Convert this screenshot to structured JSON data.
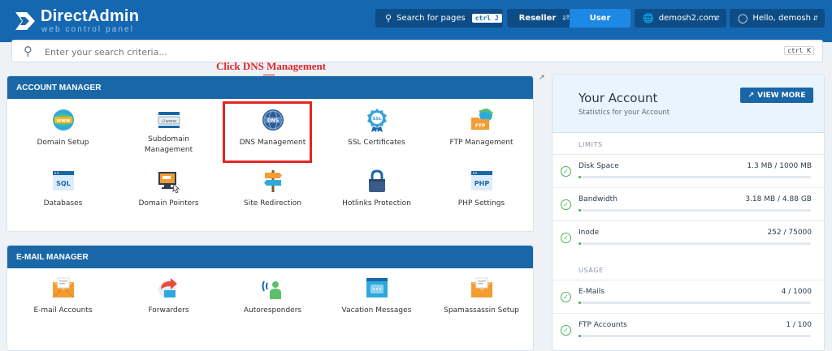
{
  "header": {
    "brand": "DirectAdmin",
    "brand_sub": "web control panel",
    "search_pages_label": "Search for pages",
    "search_pages_kbd": "ctrl J",
    "role_reseller": "Reseller",
    "role_user": "User",
    "domain": "demosh2.com",
    "greeting": "Hello, demosh"
  },
  "search": {
    "placeholder": "Enter your search criteria...",
    "kbd": "ctrl K"
  },
  "annotation": "Click DNS Management",
  "account_manager": {
    "title": "ACCOUNT MANAGER",
    "items": [
      {
        "label": "Domain Setup",
        "icon": "www-globe-icon"
      },
      {
        "label": "Subdomain Management",
        "icon": "subdomain-icon"
      },
      {
        "label": "DNS Management",
        "icon": "dns-icon"
      },
      {
        "label": "SSL Certificates",
        "icon": "ssl-badge-icon"
      },
      {
        "label": "FTP Management",
        "icon": "ftp-folder-icon"
      },
      {
        "label": "Databases",
        "icon": "sql-database-icon"
      },
      {
        "label": "Domain Pointers",
        "icon": "domain-pointer-icon"
      },
      {
        "label": "Site Redirection",
        "icon": "signpost-icon"
      },
      {
        "label": "Hotlinks Protection",
        "icon": "padlock-icon"
      },
      {
        "label": "PHP Settings",
        "icon": "php-icon"
      }
    ]
  },
  "email_manager": {
    "title": "E-MAIL MANAGER",
    "items": [
      {
        "label": "E-mail Accounts",
        "icon": "mail-envelope-icon"
      },
      {
        "label": "Forwarders",
        "icon": "forward-icon"
      },
      {
        "label": "Autoresponders",
        "icon": "autoresponder-icon"
      },
      {
        "label": "Vacation Messages",
        "icon": "vacation-message-icon"
      },
      {
        "label": "Spamassassin Setup",
        "icon": "spam-envelope-icon"
      }
    ]
  },
  "your_account": {
    "title": "Your Account",
    "subtitle": "Statistics for your Account",
    "view_more": "VIEW MORE",
    "limits_title": "LIMITS",
    "usage_title": "USAGE",
    "limits": [
      {
        "name": "Disk Space",
        "value": "1.3 MB / 1000 MB",
        "fraction": 0.0013
      },
      {
        "name": "Bandwidth",
        "value": "3.18 MB / 4.88 GB",
        "fraction": 0.0006
      },
      {
        "name": "Inode",
        "value": "252 / 75000",
        "fraction": 0.0034
      }
    ],
    "usage": [
      {
        "name": "E-Mails",
        "value": "4 / 1000",
        "fraction": 0.004
      },
      {
        "name": "FTP Accounts",
        "value": "1 / 100",
        "fraction": 0.01
      }
    ]
  },
  "colors": {
    "header": "#1567b2",
    "panel_head": "#1a67a8",
    "highlight": "#e02626",
    "ok": "#4caf50"
  }
}
